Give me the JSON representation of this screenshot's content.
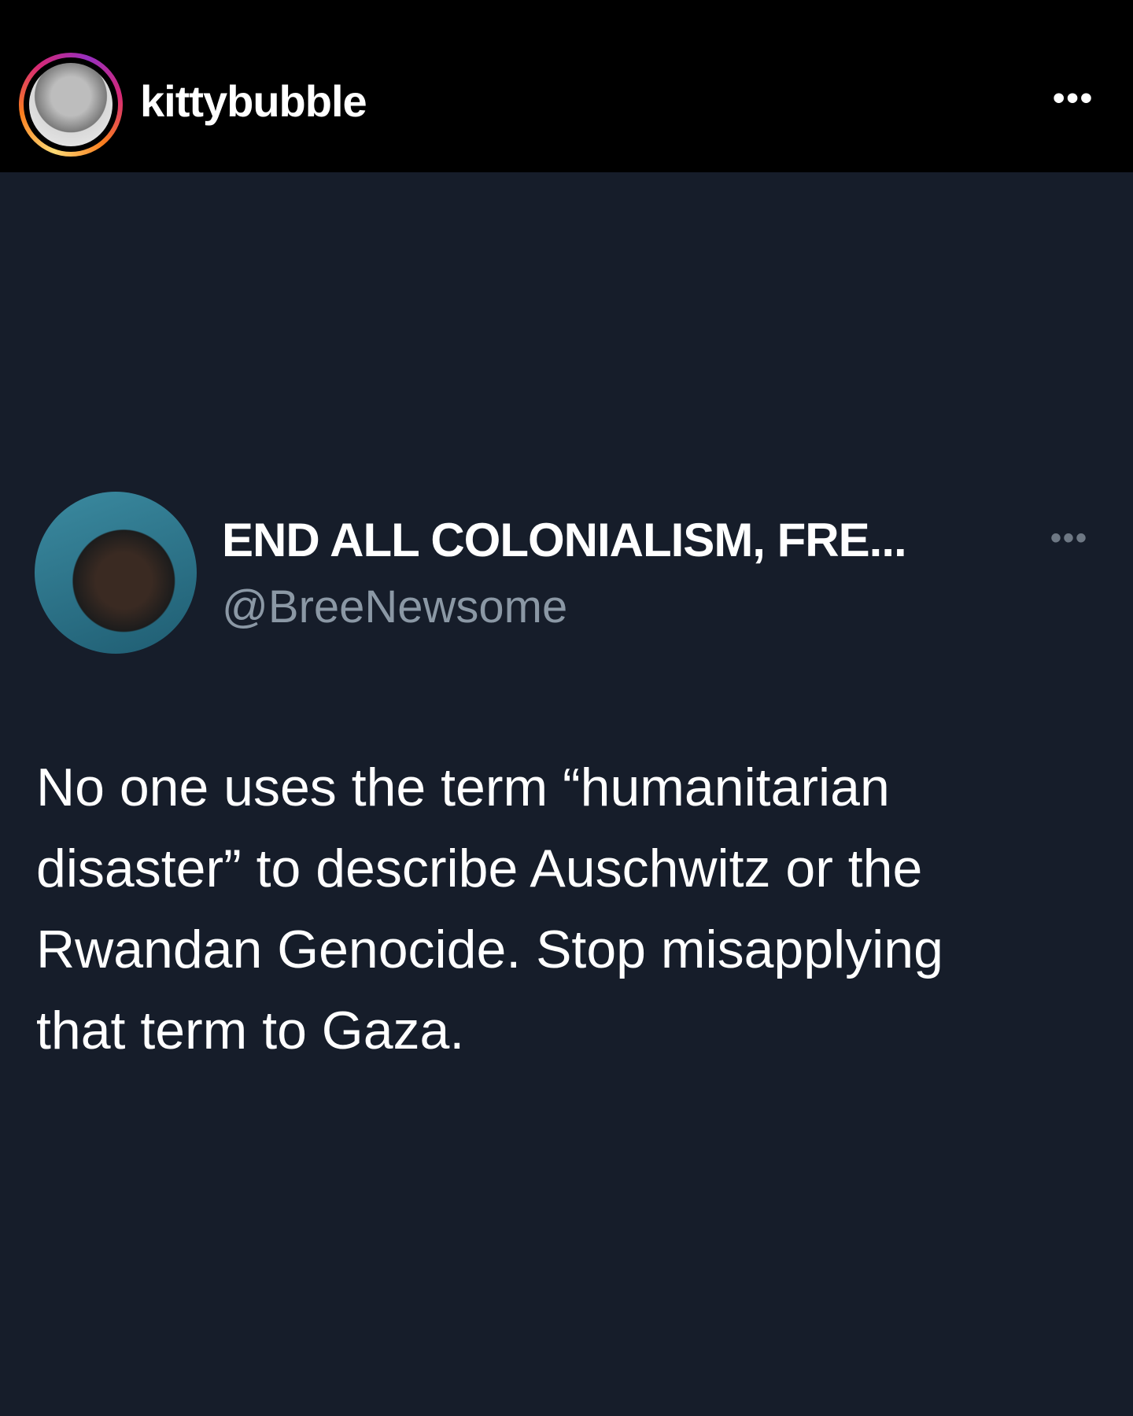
{
  "post_header": {
    "username": "kittybubble",
    "avatar_icon": "profile-avatar",
    "more_icon": "more-horizontal-icon",
    "more_label": "•••",
    "story_ring_colors": [
      "#feda75",
      "#fa7e1e",
      "#d62976",
      "#962fbf"
    ]
  },
  "tweet": {
    "display_name": "END ALL COLONIALISM, FRE...",
    "handle": "@BreeNewsome",
    "more_label": "•••",
    "body_lines": [
      "No one uses the term “humanitarian",
      "disaster” to describe Auschwitz or the",
      "Rwandan Genocide. Stop misapplying",
      "that term to Gaza."
    ]
  },
  "colors": {
    "background": "#161d2a",
    "header": "#000000",
    "handle": "#8b98a5"
  }
}
